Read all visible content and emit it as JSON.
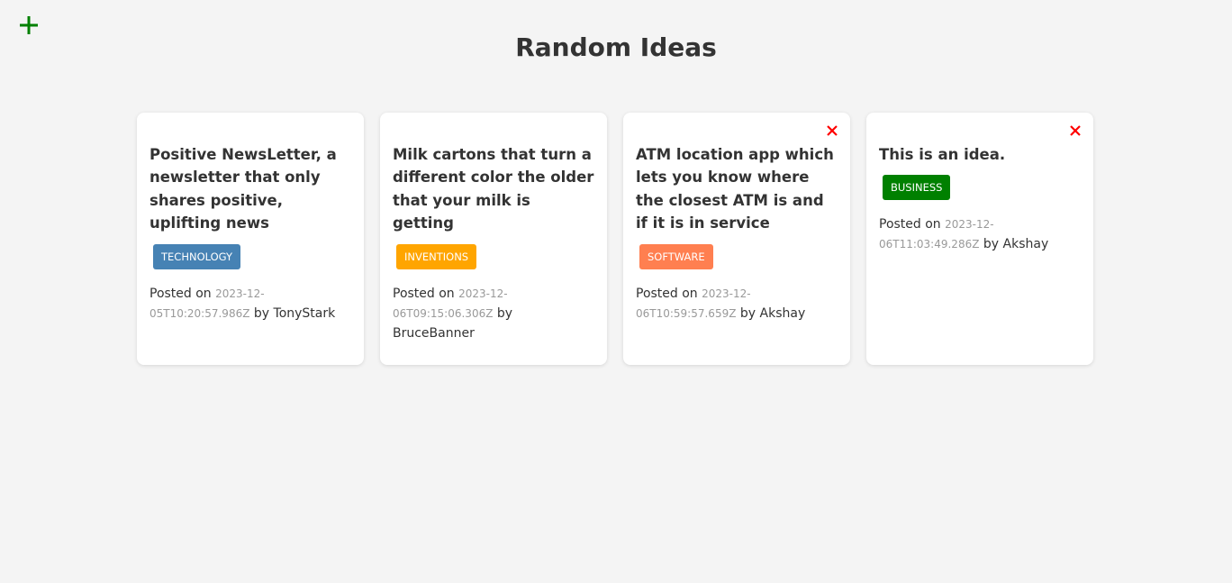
{
  "header": {
    "title": "Random Ideas",
    "add_icon": "plus-icon",
    "add_color": "#008000"
  },
  "labels": {
    "posted_on": "Posted on",
    "by": "by"
  },
  "ideas": [
    {
      "text": "Positive NewsLetter, a newsletter that only shares positive, uplifting news",
      "tag": "technology",
      "tag_color": "#4682b4",
      "date": "2023-12-05T10:20:57.986Z",
      "username": "TonyStark",
      "deletable": false
    },
    {
      "text": "Milk cartons that turn a different color the older that your milk is getting",
      "tag": "inventions",
      "tag_color": "#ffa500",
      "date": "2023-12-06T09:15:06.306Z",
      "username": "BruceBanner",
      "deletable": false
    },
    {
      "text": "ATM location app which lets you know where the closest ATM is and if it is in service",
      "tag": "software",
      "tag_color": "#ff7f50",
      "date": "2023-12-06T10:59:57.659Z",
      "username": "Akshay",
      "deletable": true
    },
    {
      "text": "This is an idea.",
      "tag": "business",
      "tag_color": "#008000",
      "date": "2023-12-06T11:03:49.286Z",
      "username": "Akshay",
      "deletable": true
    }
  ],
  "delete_icon": "close-icon",
  "delete_color": "#ff0000"
}
